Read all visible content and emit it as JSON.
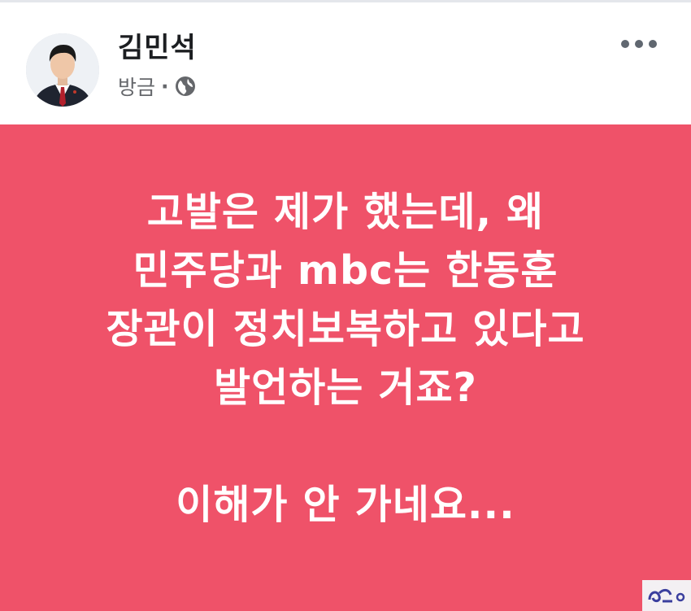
{
  "post": {
    "author": "김민석",
    "time": "방금",
    "separator": "·",
    "privacy_icon": "globe-icon",
    "more_icon": "more-options-icon",
    "background_color": "#ef5269",
    "text_color": "#ffffff",
    "lines": [
      "고발은 제가 했는데, 왜",
      "민주당과 mbc는 한동훈",
      "장관이 정치보복하고 있다고",
      "발언하는 거죠?"
    ],
    "closing_line": "이해가 안 가네요..."
  },
  "watermark": {
    "icon": "site-logo-icon"
  }
}
